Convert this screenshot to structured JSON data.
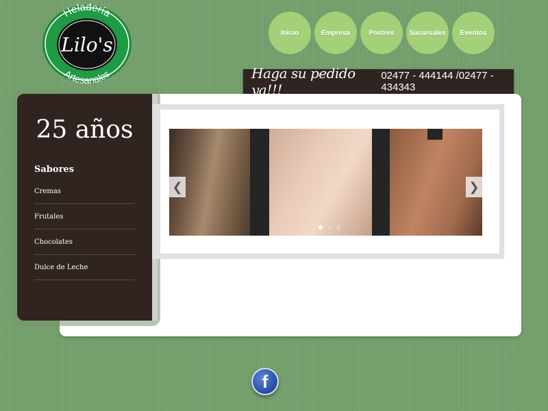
{
  "logo": {
    "top_text": "Heladería",
    "script_text": "Lilo's",
    "bottom_text": "Artesanales"
  },
  "nav": {
    "items": [
      {
        "label": "Inicio"
      },
      {
        "label": "Empresa"
      },
      {
        "label": "Postres"
      },
      {
        "label": "Sucursales"
      },
      {
        "label": "Eventos"
      }
    ]
  },
  "order_banner": {
    "text": "Haga su pedido ya!!!",
    "phones": "02477 - 444144 /02477 - 434343"
  },
  "sidebar": {
    "title": "25 años",
    "heading": "Sabores",
    "items": [
      {
        "label": "Cremas"
      },
      {
        "label": "Frutales"
      },
      {
        "label": "Chocolates"
      },
      {
        "label": "Dulce de Leche"
      }
    ]
  },
  "slider": {
    "prev_icon": "chevron-left-icon",
    "next_icon": "chevron-right-icon",
    "dot_count": 4,
    "active_dot": 2
  },
  "social": {
    "facebook_icon": "facebook-icon",
    "letter": "f"
  },
  "colors": {
    "background": "#74a06c",
    "nav": "#a3d078",
    "dark": "#2f2420"
  }
}
